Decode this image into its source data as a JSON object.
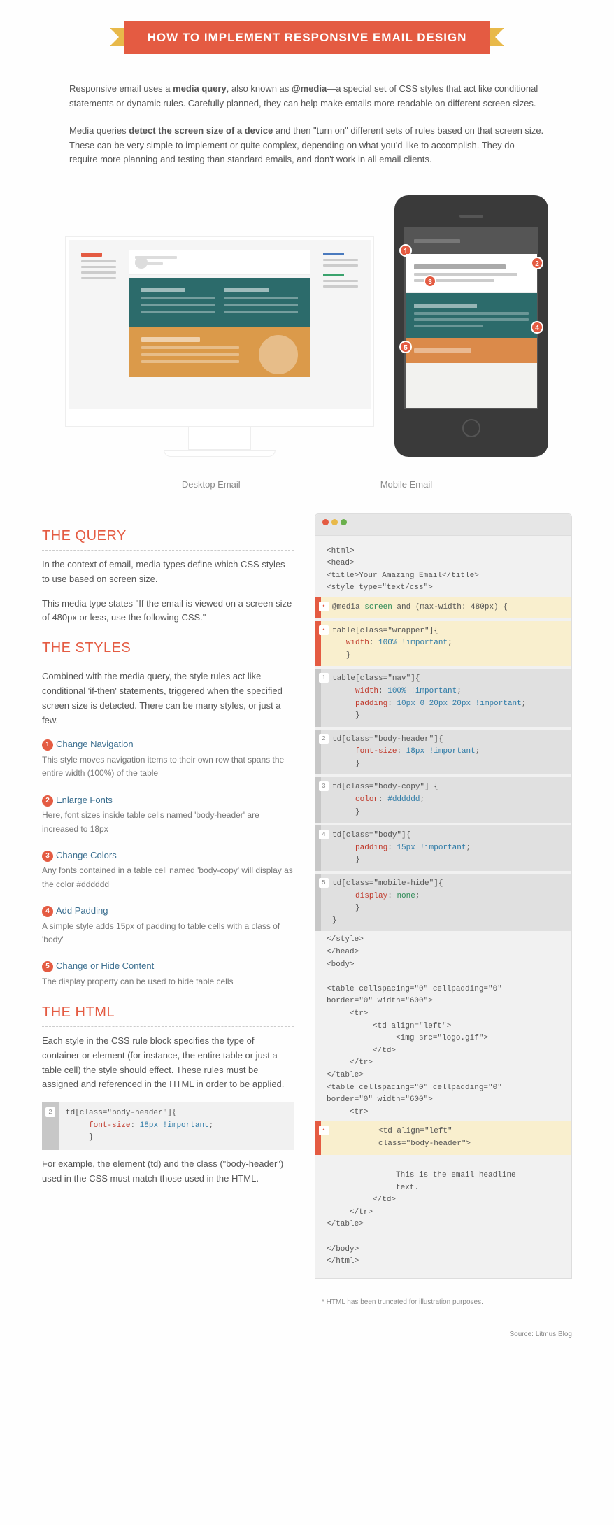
{
  "title": "HOW TO IMPLEMENT RESPONSIVE EMAIL DESIGN",
  "intro": {
    "p1_a": "Responsive email uses a ",
    "p1_b1": "media query",
    "p1_c": ", also known as ",
    "p1_b2": "@media",
    "p1_d": "—a special set of CSS styles that act like conditional statements or dynamic rules. Carefully planned, they can help make emails more readable on different screen sizes.",
    "p2_a": "Media queries ",
    "p2_b": "detect the screen size of a device",
    "p2_c": " and then \"turn on\" different sets of rules based on that screen size. These can be very simple to implement or quite complex, depending on what you'd like to accomplish. They do require more planning and testing than standard emails, and don't work in all email clients."
  },
  "devices": {
    "desktop_label": "Desktop Email",
    "mobile_label": "Mobile Email",
    "markers": [
      "1",
      "2",
      "3",
      "4",
      "5"
    ]
  },
  "sections": {
    "query": {
      "heading": "THE QUERY",
      "p1": "In the context of email, media types define which CSS styles to use based on screen size.",
      "p2": "This media type states \"If the email is viewed on a screen size of 480px or less, use the following CSS.\""
    },
    "styles": {
      "heading": "THE STYLES",
      "p1": "Combined with the media query, the style rules act like conditional 'if-then' statements, triggered when the specified screen size is detected. There can be many styles, or just a few.",
      "items": [
        {
          "n": "1",
          "title": "Change Navigation",
          "desc": "This style moves navigation items to their own row that spans the entire width (100%) of the table"
        },
        {
          "n": "2",
          "title": "Enlarge Fonts",
          "desc": "Here, font sizes inside table cells named 'body-header' are increased to 18px"
        },
        {
          "n": "3",
          "title": "Change Colors",
          "desc": "Any fonts contained in a table cell named 'body-copy' will display as the color #dddddd"
        },
        {
          "n": "4",
          "title": "Add Padding",
          "desc": "A simple style adds 15px of padding to table cells with a class of 'body'"
        },
        {
          "n": "5",
          "title": "Change or Hide Content",
          "desc": "The display property can be used to hide table cells"
        }
      ]
    },
    "html": {
      "heading": "THE HTML",
      "p1": "Each style in the CSS rule block specifies the type of container or element (for instance, the entire table or just a table cell) the style should effect. These rules must be assigned and referenced in the HTML in order to be applied.",
      "mini_badge": "2",
      "mini_line1": "td[class=\"body-header\"]{",
      "mini_line2_a": "font-size",
      "mini_line2_b": ": ",
      "mini_line2_c": "18px !important",
      "mini_line2_d": ";",
      "mini_line3": "}",
      "p2": "For example, the element (td) and the class (\"body-header\") used in the CSS must match those used in the HTML."
    }
  },
  "code": {
    "head": "<html>\n<head>\n<title>Your Amazing Email</title>\n<style type=\"text/css\">",
    "media": {
      "badge": "•",
      "a": "@media ",
      "b": "screen",
      "c": " and (max-width: 480px) {"
    },
    "wrapper": {
      "badge": "•",
      "l1": "table[class=\"wrapper\"]{",
      "l2a": "width",
      "l2b": "100% !important",
      "l3": "}"
    },
    "b1": {
      "badge": "1",
      "l1": "table[class=\"nav\"]{",
      "l2a": "width",
      "l2b": "100% !important",
      "l3a": "padding",
      "l3b": "10px 0 20px 20px !important",
      "l4": "}"
    },
    "b2": {
      "badge": "2",
      "l1": "td[class=\"body-header\"]{",
      "l2a": "font-size",
      "l2b": "18px !important",
      "l3": "}"
    },
    "b3": {
      "badge": "3",
      "l1": "td[class=\"body-copy\"] {",
      "l2a": "color",
      "l2b": "#dddddd",
      "l3": "}"
    },
    "b4": {
      "badge": "4",
      "l1": "td[class=\"body\"]{",
      "l2a": "padding",
      "l2b": "15px !important",
      "l3": "}"
    },
    "b5": {
      "badge": "5",
      "l1": "td[class=\"mobile-hide\"]{",
      "l2a": "display",
      "l2b": "none",
      "l3": "}",
      "l4": "}"
    },
    "mid": "</style>\n</head>\n<body>\n\n<table cellspacing=\"0\" cellpadding=\"0\"\nborder=\"0\" width=\"600\">\n     <tr>\n          <td align=\"left\">\n               <img src=\"logo.gif\">\n          </td>\n     </tr>\n</table>\n<table cellspacing=\"0\" cellpadding=\"0\"\nborder=\"0\" width=\"600\">\n     <tr>",
    "hlhtml": {
      "badge": "•",
      "l1": "          <td align=\"left\"",
      "l2": "          class=\"body-header\">"
    },
    "tail": "\n               This is the email headline\n               text.\n          </td>\n     </tr>\n</table>\n\n</body>\n</html>"
  },
  "footnote": "* HTML has been truncated for illustration purposes.",
  "source": "Source: Litmus Blog"
}
